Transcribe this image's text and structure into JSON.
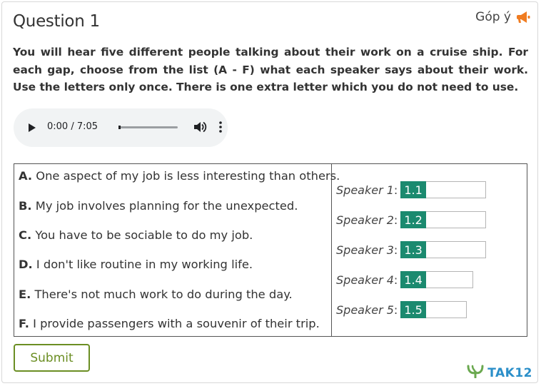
{
  "question": {
    "title": "Question 1"
  },
  "feedback": {
    "label": "Góp ý",
    "icon": "megaphone-icon",
    "icon_color": "#f07c21"
  },
  "instructions": "You will hear five different people talking about their work on a cruise ship. For each gap, choose from the list (A - F) what each speaker says about their work. Use the letters only once. There is one extra letter which you do not need to use.",
  "audio_player": {
    "time": "0:00 / 7:05",
    "progress": 0.0
  },
  "options": [
    {
      "letter": "A.",
      "text": " One aspect of my job is less interesting than others."
    },
    {
      "letter": "B.",
      "text": " My job involves planning for the unexpected."
    },
    {
      "letter": "C.",
      "text": " You have to be sociable to do my job."
    },
    {
      "letter": "D.",
      "text": " I don't like routine in my working life."
    },
    {
      "letter": "E.",
      "text": " There's not much work to do during the day."
    },
    {
      "letter": "F.",
      "text": " I provide passengers with a souvenir of their trip."
    }
  ],
  "speakers": [
    {
      "label": "Speaker 1",
      "gap": "1.1",
      "value": ""
    },
    {
      "label": "Speaker 2",
      "gap": "1.2",
      "value": ""
    },
    {
      "label": "Speaker 3",
      "gap": "1.3",
      "value": ""
    },
    {
      "label": "Speaker 4",
      "gap": "1.4",
      "value": ""
    },
    {
      "label": "Speaker 5",
      "gap": "1.5",
      "value": ""
    }
  ],
  "submit_label": "Submit",
  "brand": {
    "name": "TAK12",
    "icon": "tak12-logo-icon",
    "color": "#2b8fc9",
    "accent": "#6aa84f"
  },
  "colors": {
    "gap_badge": "#1b8a6f",
    "submit": "#6b8e23"
  }
}
